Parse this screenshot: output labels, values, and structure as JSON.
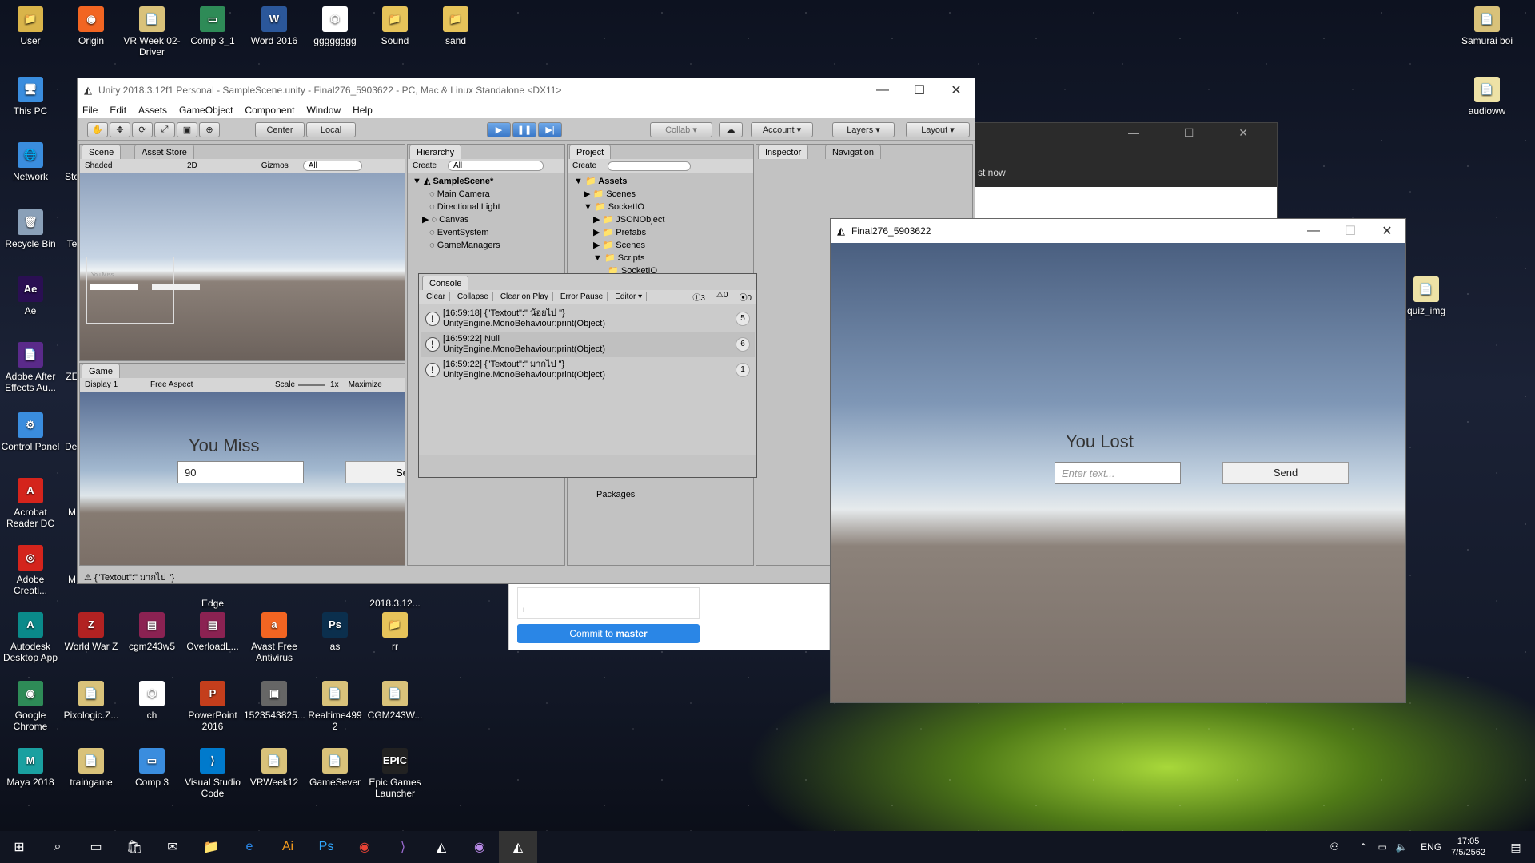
{
  "desktop": {
    "icons": [
      {
        "label": "User",
        "glyph": "📁",
        "color": "#d9b44a"
      },
      {
        "label": "Origin",
        "glyph": "◉",
        "color": "#f26522"
      },
      {
        "label": "VR Week 02-Driver",
        "glyph": "📄",
        "color": "#d9c27a"
      },
      {
        "label": "Comp 3_1",
        "glyph": "▭",
        "color": "#2e8b57"
      },
      {
        "label": "Word 2016",
        "glyph": "W",
        "color": "#2b579a"
      },
      {
        "label": "gggggggg",
        "glyph": "⬡",
        "color": "#ffffff"
      },
      {
        "label": "Sound",
        "glyph": "📁",
        "color": "#e6c35a"
      },
      {
        "label": "sand",
        "glyph": "📁",
        "color": "#e6c35a"
      },
      {
        "label": "Samurai boi",
        "glyph": "📄",
        "color": "#d9c27a"
      },
      {
        "label": "This PC",
        "glyph": "🖥",
        "color": "#3a8dde"
      },
      {
        "label": "audioww",
        "glyph": "📄",
        "color": "#eee2a6"
      },
      {
        "label": "Network",
        "glyph": "🌐",
        "color": "#3a8dde"
      },
      {
        "label": "Sto",
        "glyph": "",
        "color": "transparent"
      },
      {
        "label": "Recycle Bin",
        "glyph": "🗑",
        "color": "#8aa0b8"
      },
      {
        "label": "Te",
        "glyph": "",
        "color": "transparent"
      },
      {
        "label": "quiz_img",
        "glyph": "📄",
        "color": "#eee2a6"
      },
      {
        "label": "Ae",
        "glyph": "Ae",
        "color": "#2a0f52"
      },
      {
        "label": "Adobe After Effects Au...",
        "glyph": "📄",
        "color": "#5a2a8a"
      },
      {
        "label": "ZE",
        "glyph": "",
        "color": "transparent"
      },
      {
        "label": "Control Panel",
        "glyph": "⚙",
        "color": "#3a8dde"
      },
      {
        "label": "Dei",
        "glyph": "",
        "color": "transparent"
      },
      {
        "label": "Acrobat Reader DC",
        "glyph": "A",
        "color": "#d4241c"
      },
      {
        "label": "M",
        "glyph": "",
        "color": "transparent"
      },
      {
        "label": "Adobe Creati...",
        "glyph": "◎",
        "color": "#d4241c"
      },
      {
        "label": "M",
        "glyph": "",
        "color": "transparent"
      },
      {
        "label": "Edge",
        "glyph": "",
        "color": "transparent"
      },
      {
        "label": "2018.3.12...",
        "glyph": "",
        "color": "transparent"
      },
      {
        "label": "Autodesk Desktop App",
        "glyph": "A",
        "color": "#0a8a8a"
      },
      {
        "label": "World War Z",
        "glyph": "Z",
        "color": "#b22222"
      },
      {
        "label": "cgm243w5",
        "glyph": "▤",
        "color": "#8b2252"
      },
      {
        "label": "OverloadL...",
        "glyph": "▤",
        "color": "#8b2252"
      },
      {
        "label": "Avast Free Antivirus",
        "glyph": "a",
        "color": "#f26522"
      },
      {
        "label": "as",
        "glyph": "Ps",
        "color": "#0b2f4d"
      },
      {
        "label": "rr",
        "glyph": "📁",
        "color": "#e6c35a"
      },
      {
        "label": "Google Chrome",
        "glyph": "◉",
        "color": "#2e8b57"
      },
      {
        "label": "Pixologic.Z...",
        "glyph": "📄",
        "color": "#d9c27a"
      },
      {
        "label": "ch",
        "glyph": "⬡",
        "color": "#ffffff"
      },
      {
        "label": "PowerPoint 2016",
        "glyph": "P",
        "color": "#c43e1c"
      },
      {
        "label": "1523543825...",
        "glyph": "▣",
        "color": "#666"
      },
      {
        "label": "Realtime499 2",
        "glyph": "📄",
        "color": "#d9c27a"
      },
      {
        "label": "CGM243W...",
        "glyph": "📄",
        "color": "#d9c27a"
      },
      {
        "label": "Maya 2018",
        "glyph": "M",
        "color": "#1aa0a0"
      },
      {
        "label": "traingame",
        "glyph": "📄",
        "color": "#d9c27a"
      },
      {
        "label": "Comp 3",
        "glyph": "▭",
        "color": "#3a8dde"
      },
      {
        "label": "Visual Studio Code",
        "glyph": "⟩",
        "color": "#007acc"
      },
      {
        "label": "VRWeek12",
        "glyph": "📄",
        "color": "#d9c27a"
      },
      {
        "label": "GameSever",
        "glyph": "📄",
        "color": "#d9c27a"
      },
      {
        "label": "Epic Games Launcher",
        "glyph": "EPIC",
        "color": "#222"
      }
    ]
  },
  "unity": {
    "title": "Unity 2018.3.12f1 Personal - SampleScene.unity - Final276_5903622 - PC, Mac & Linux Standalone <DX11>",
    "menu": [
      "File",
      "Edit",
      "Assets",
      "GameObject",
      "Component",
      "Window",
      "Help"
    ],
    "toolbar": {
      "center": "Center",
      "local": "Local",
      "collab": "Collab",
      "account": "Account",
      "layers": "Layers",
      "layout": "Layout"
    },
    "scene": {
      "tab": "Scene",
      "tab2": "Asset Store",
      "shaded": "Shaded",
      "mode2d": "2D",
      "gizmos": "Gizmos",
      "search": "All",
      "miss_small": "You Miss"
    },
    "game": {
      "tab": "Game",
      "display": "Display 1",
      "aspect": "Free Aspect",
      "scale_label": "Scale",
      "scale_value": "1x",
      "maximize": "Maximize",
      "heading": "You Miss",
      "input_value": "90",
      "send": "Se"
    },
    "hierarchy": {
      "tab": "Hierarchy",
      "create": "Create",
      "search": "All",
      "scene": "SampleScene*",
      "items": [
        "Main Camera",
        "Directional Light",
        "Canvas",
        "EventSystem",
        "GameManagers"
      ]
    },
    "project": {
      "tab": "Project",
      "create": "Create",
      "root": "Assets",
      "items": [
        "Scenes",
        "SocketIO",
        "JSONObject",
        "Prefabs",
        "Scenes",
        "Scripts",
        "SocketIO"
      ],
      "packages": "Packages"
    },
    "inspector": {
      "tab": "Inspector",
      "tab2": "Navigation"
    },
    "console": {
      "tab": "Console",
      "buttons": [
        "Clear",
        "Collapse",
        "Clear on Play",
        "Error Pause",
        "Editor"
      ],
      "count_log": "3",
      "count_warn": "0",
      "count_err": "0",
      "rows": [
        {
          "line1": "[16:59:18] {\"Textout\":\" น้อยไป \"}",
          "line2": "UnityEngine.MonoBehaviour:print(Object)",
          "count": "5"
        },
        {
          "line1": "[16:59:22] Null",
          "line2": "UnityEngine.MonoBehaviour:print(Object)",
          "count": "6"
        },
        {
          "line1": "[16:59:22] {\"Textout\":\" มากไป \"}",
          "line2": "UnityEngine.MonoBehaviour:print(Object)",
          "count": "1"
        }
      ]
    },
    "statusbar": "{\"Textout\":\" มากไป \"}"
  },
  "bgwindow": {
    "text": "st now"
  },
  "github": {
    "commit_prefix": "Commit to ",
    "commit_branch": "master",
    "coauthor": "+"
  },
  "player": {
    "title": "Final276_5903622",
    "heading": "You Lost",
    "placeholder": "Enter text...",
    "send": "Send"
  },
  "taskbar": {
    "lang": "ENG",
    "time": "17:05",
    "date": "7/5/2562"
  }
}
